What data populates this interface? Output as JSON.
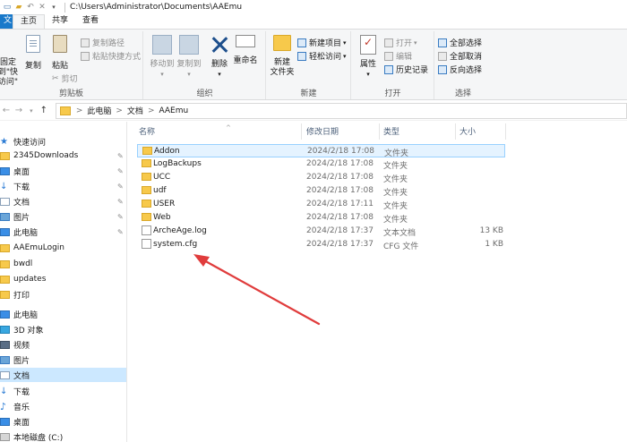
{
  "window": {
    "path": "C:\\Users\\Administrator\\Documents\\AAEmu"
  },
  "ribbon_tabs": {
    "file": "文件",
    "home": "主页",
    "share": "共享",
    "view": "查看"
  },
  "ribbon": {
    "clipboard": {
      "pin_label_1": "固定到\"快",
      "pin_label_2": "访问\"",
      "copy": "复制",
      "paste": "粘贴",
      "copy_path": "复制路径",
      "paste_shortcut": "粘贴快捷方式",
      "cut": "剪切",
      "group": "剪贴板"
    },
    "organize": {
      "move_to": "移动到",
      "copy_to": "复制到",
      "delete": "删除",
      "rename": "重命名",
      "group": "组织"
    },
    "new": {
      "new_folder_1": "新建",
      "new_folder_2": "文件夹",
      "new_item": "新建项目",
      "easy_access": "轻松访问",
      "group": "新建"
    },
    "open": {
      "properties": "属性",
      "open": "打开",
      "edit": "编辑",
      "history": "历史记录",
      "group": "打开"
    },
    "select": {
      "select_all": "全部选择",
      "select_none": "全部取消",
      "invert": "反向选择",
      "group": "选择"
    }
  },
  "address_bar": {
    "crumbs": [
      "此电脑",
      "文档",
      "AAEmu"
    ],
    "separator": ">"
  },
  "nav_pane": {
    "quick_access": "快速访问",
    "items": [
      {
        "label": "2345Downloads",
        "icon": "folder-icon"
      },
      {
        "label": "桌面",
        "icon": "desktop-icon"
      },
      {
        "label": "下载",
        "icon": "download-icon"
      },
      {
        "label": "文档",
        "icon": "documents-icon"
      },
      {
        "label": "图片",
        "icon": "pictures-icon"
      },
      {
        "label": "此电脑",
        "icon": "this-pc-icon"
      },
      {
        "label": "AAEmuLogin",
        "icon": "folder-icon"
      },
      {
        "label": "bwdl",
        "icon": "folder-icon"
      },
      {
        "label": "updates",
        "icon": "folder-icon"
      },
      {
        "label": "打印",
        "icon": "folder-icon"
      }
    ],
    "this_pc": "此电脑",
    "pc_items": [
      {
        "label": "3D 对象",
        "icon": "3d-objects-icon"
      },
      {
        "label": "视频",
        "icon": "videos-icon"
      },
      {
        "label": "图片",
        "icon": "pictures-icon"
      },
      {
        "label": "文档",
        "icon": "documents-icon"
      },
      {
        "label": "下载",
        "icon": "download-icon"
      },
      {
        "label": "音乐",
        "icon": "music-icon"
      },
      {
        "label": "桌面",
        "icon": "desktop-icon"
      },
      {
        "label": "本地磁盘 (C:)",
        "icon": "drive-icon"
      }
    ]
  },
  "file_list": {
    "columns": {
      "name": "名称",
      "modified": "修改日期",
      "type": "类型",
      "size": "大小"
    },
    "rows": [
      {
        "name": "Addon",
        "modified": "2024/2/18 17:08",
        "type": "文件夹",
        "size": "",
        "kind": "folder"
      },
      {
        "name": "LogBackups",
        "modified": "2024/2/18 17:08",
        "type": "文件夹",
        "size": "",
        "kind": "folder"
      },
      {
        "name": "UCC",
        "modified": "2024/2/18 17:08",
        "type": "文件夹",
        "size": "",
        "kind": "folder"
      },
      {
        "name": "udf",
        "modified": "2024/2/18 17:08",
        "type": "文件夹",
        "size": "",
        "kind": "folder"
      },
      {
        "name": "USER",
        "modified": "2024/2/18 17:11",
        "type": "文件夹",
        "size": "",
        "kind": "folder"
      },
      {
        "name": "Web",
        "modified": "2024/2/18 17:08",
        "type": "文件夹",
        "size": "",
        "kind": "folder"
      },
      {
        "name": "ArcheAge.log",
        "modified": "2024/2/18 17:37",
        "type": "文本文档",
        "size": "13 KB",
        "kind": "file"
      },
      {
        "name": "system.cfg",
        "modified": "2024/2/18 17:37",
        "type": "CFG 文件",
        "size": "1 KB",
        "kind": "file"
      }
    ]
  },
  "annotation": {
    "arrow_color": "#e03c3c"
  }
}
